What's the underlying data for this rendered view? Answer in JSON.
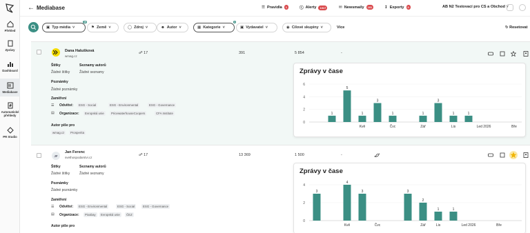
{
  "sidebar": {
    "items": [
      {
        "label": "Přehled",
        "icon": "home-icon"
      },
      {
        "label": "Zprávy",
        "icon": "document-icon"
      },
      {
        "label": "Dashboard",
        "icon": "bar-chart-icon"
      },
      {
        "label": "Mediabase",
        "icon": "mediabase-icon"
      },
      {
        "label": "Automatické přehledy",
        "icon": "auto-report-icon"
      },
      {
        "label": "PR Studio",
        "icon": "pr-studio-icon"
      }
    ]
  },
  "header": {
    "title": "Mediabase",
    "pravidla": "Pravidla",
    "pravidla_badge": "1",
    "alerty": "Alerty",
    "alerty_badge": "1017",
    "newsmaily": "Newsmaily",
    "newsmaily_badge": "101",
    "exporty": "Exporty",
    "exporty_badge": "0",
    "org": "AB N2 Testovací pro CS a Obchod"
  },
  "filters": {
    "typ_medii": "Typ média",
    "typ_medii_count": "10",
    "zeme": "Země",
    "zdroj": "Zdroj",
    "autor": "Autor",
    "kategorie": "Kategorie",
    "kategorie_count": "1",
    "vydavatel": "Vydavatel",
    "cilove": "Cílové skupiny",
    "vice": "Více",
    "reset": "Resetovat"
  },
  "rows": [
    {
      "initials": "",
      "name": "Dana Halušková",
      "email": "wmag.cz",
      "views": "17",
      "metric1": "391",
      "metric2": "5 854",
      "dash": "-",
      "stitky_label": "Štítky",
      "stitky": "Žádné štítky",
      "seznamy_label": "Seznamy autorů",
      "seznamy": "Žádné seznamy",
      "poznamky_label": "Poznámky",
      "poznamky": "Žádné poznámky",
      "zamereni_label": "Zaměření",
      "odvetvi_label": "Odvětví:",
      "odvetvi": [
        "ESG - Social",
        "ESG - Environmental",
        "ESG - Governance"
      ],
      "organizace_label": "Organizace:",
      "organizace": [
        "Evropská unie",
        "PricewaterhouseCoopers",
        "CFA Institute"
      ],
      "autor_pise_label": "Autor píše pro",
      "autor_pise": [
        "wmag.cz",
        "Prosperita"
      ],
      "chart_data": {
        "type": "bar",
        "title": "Zprávy v čase",
        "ylim": [
          0,
          6
        ],
        "yticks": [
          0,
          2,
          4,
          6
        ],
        "categories": [
          "",
          "",
          "",
          "Kvě",
          "",
          "Čvc",
          "",
          "Zář",
          "",
          "Lis",
          "",
          "Led 2026",
          "",
          "Bře"
        ],
        "values": [
          0,
          1,
          5,
          1,
          3,
          1,
          0,
          1,
          3,
          1,
          1,
          0,
          0,
          0
        ],
        "color": "#3b8f84"
      }
    },
    {
      "initials": "JF",
      "name": "Jan Ferenc",
      "email": "svethospodarstvi.cz",
      "views": "17",
      "metric1": "13 369",
      "metric2": "1 500",
      "dash": "-",
      "stitky_label": "Štítky",
      "stitky": "Žádné štítky",
      "seznamy_label": "Seznamy autorů",
      "seznamy": "Žádné seznamy",
      "poznamky_label": "Poznámky",
      "poznamky": "Žádné poznámky",
      "zamereni_label": "Zaměření",
      "odvetvi_label": "Odvětví:",
      "odvetvi": [
        "ESG - Environmental",
        "ESG - Social",
        "ESG - Governance"
      ],
      "organizace_label": "Organizace:",
      "organizace": [
        "Pixabay",
        "Evropská unie",
        "ČEZ"
      ],
      "autor_pise_label": "Autor píše pro",
      "chart_data": {
        "type": "bar",
        "title": "Zprávy v čase",
        "ylim": [
          0,
          4
        ],
        "yticks": [
          0,
          2,
          4
        ],
        "categories": [
          "",
          "",
          "Kvě",
          "",
          "Čvc",
          "",
          "",
          "Zář",
          "Lis",
          "",
          "Led 2026",
          "",
          "Bře",
          ""
        ],
        "values": [
          3,
          0,
          4,
          3,
          0,
          0,
          3,
          2,
          1,
          1,
          0,
          0,
          0,
          0
        ],
        "color": "#3b8f84"
      }
    }
  ]
}
